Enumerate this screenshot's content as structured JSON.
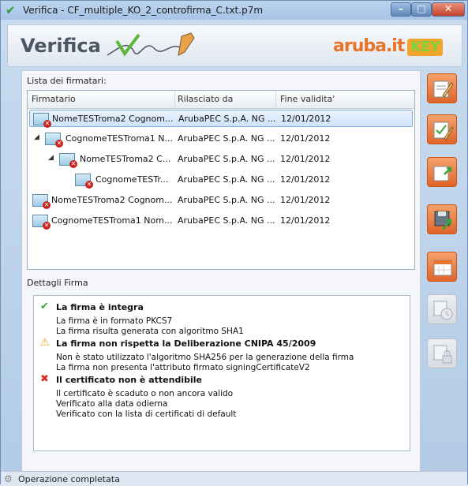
{
  "window": {
    "title": "Verifica - CF_multiple_KO_2_controfirma_C.txt.p7m"
  },
  "header": {
    "title": "Verifica",
    "logo_text": "aruba.it",
    "logo_key": "KEY"
  },
  "signers": {
    "label": "Lista dei firmatari:",
    "columns": [
      "Firmatario",
      "Rilasciato da",
      "Fine validita'"
    ],
    "rows": [
      {
        "name": "NomeTESTroma2 Cognom...",
        "issuer": "ArubaPEC S.p.A. NG ...",
        "expiry": "12/01/2012"
      },
      {
        "name": "CognomeTESTroma1 N...",
        "issuer": "ArubaPEC S.p.A. NG ...",
        "expiry": "12/01/2012"
      },
      {
        "name": "NomeTESTroma2 C...",
        "issuer": "ArubaPEC S.p.A. NG ...",
        "expiry": "12/01/2012"
      },
      {
        "name": "CognomeTESTr...",
        "issuer": "ArubaPEC S.p.A. NG ...",
        "expiry": "12/01/2012"
      },
      {
        "name": "NomeTESTroma2 Cognom...",
        "issuer": "ArubaPEC S.p.A. NG ...",
        "expiry": "12/01/2012"
      },
      {
        "name": "CognomeTESTroma1 Nom...",
        "issuer": "ArubaPEC S.p.A. NG ...",
        "expiry": "12/01/2012"
      }
    ]
  },
  "details": {
    "label": "Dettagli Firma",
    "sections": [
      {
        "status": "ok",
        "heading": "La firma è integra",
        "lines": [
          "La firma è in formato PKCS7",
          "La firma risulta generata con algoritmo SHA1"
        ]
      },
      {
        "status": "warning",
        "heading": "La firma non rispetta la Deliberazione CNIPA 45/2009",
        "lines": [
          "Non è stato utilizzato l'algoritmo SHA256 per la generazione della firma",
          "La firma non presenta l'attributo firmato signingCertificateV2"
        ]
      },
      {
        "status": "error",
        "heading": "Il certificato non è attendibile",
        "lines": [
          "Il certificato è scaduto o non ancora valido",
          "Verificato alla data odierna",
          "Verificato con la lista di certificati di default"
        ]
      }
    ]
  },
  "colors": {
    "ok": "#3aa53a",
    "warning": "#f0a21d",
    "error": "#d42a1f",
    "accent": "#e8742a"
  },
  "status_bar": {
    "text": "Operazione completata"
  }
}
